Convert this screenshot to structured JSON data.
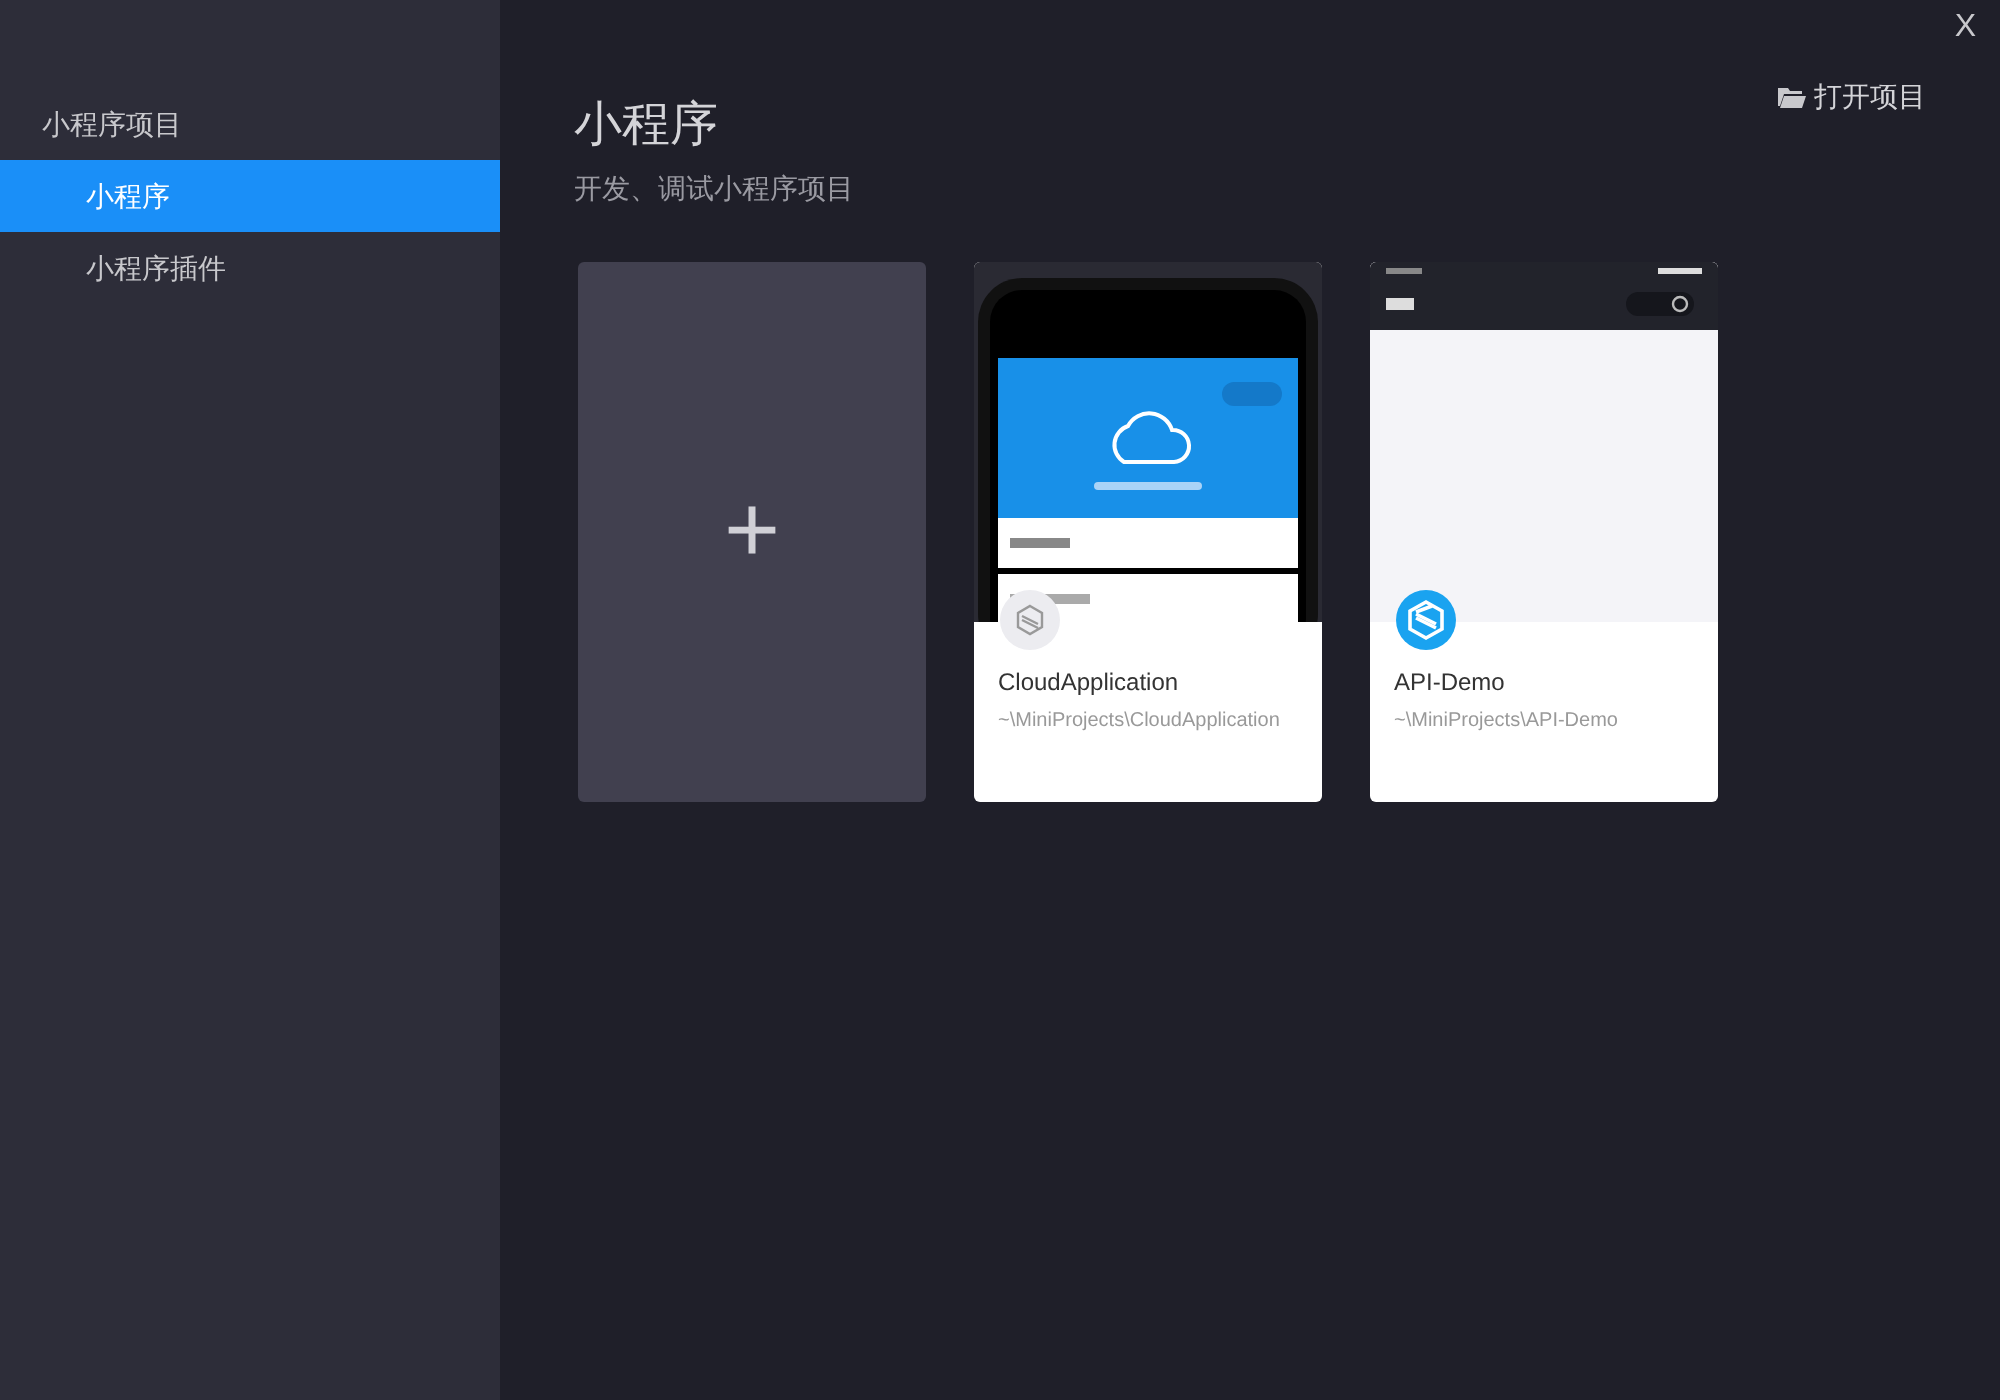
{
  "close_button": {
    "label": "X"
  },
  "sidebar": {
    "section": "小程序项目",
    "items": [
      {
        "label": "小程序",
        "selected": true
      },
      {
        "label": "小程序插件",
        "selected": false
      }
    ]
  },
  "header": {
    "title": "小程序",
    "subtitle": "开发、调试小程序项目",
    "open_button": "打开项目"
  },
  "new_project": {
    "label": "+"
  },
  "projects": [
    {
      "name": "CloudApplication",
      "path": "~\\MiniProjects\\CloudApplication",
      "kind": "phone",
      "icon_active": false
    },
    {
      "name": "API-Demo",
      "path": "~\\MiniProjects\\API-Demo",
      "kind": "page",
      "icon_active": true
    }
  ]
}
